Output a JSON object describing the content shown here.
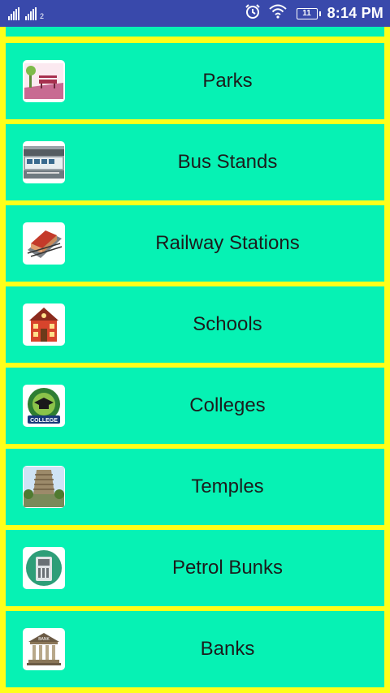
{
  "status_bar": {
    "sim2_label": "2",
    "battery_level": "11",
    "time": "8:14 PM",
    "background": "#3949AB"
  },
  "colors": {
    "page_bg": "#FFFF19",
    "tile_bg": "#06F2B4",
    "text": "#1c1c1c"
  },
  "categories": [
    {
      "label": "Parks",
      "icon": "park-icon"
    },
    {
      "label": "Bus Stands",
      "icon": "bus-stand-icon"
    },
    {
      "label": "Railway Stations",
      "icon": "railway-station-icon"
    },
    {
      "label": "Schools",
      "icon": "school-icon"
    },
    {
      "label": "Colleges",
      "icon": "college-icon",
      "icon_text": "COLLEGE"
    },
    {
      "label": "Temples",
      "icon": "temple-icon"
    },
    {
      "label": "Petrol Bunks",
      "icon": "petrol-bunk-icon"
    },
    {
      "label": "Banks",
      "icon": "bank-icon",
      "icon_text": "BANK"
    }
  ]
}
